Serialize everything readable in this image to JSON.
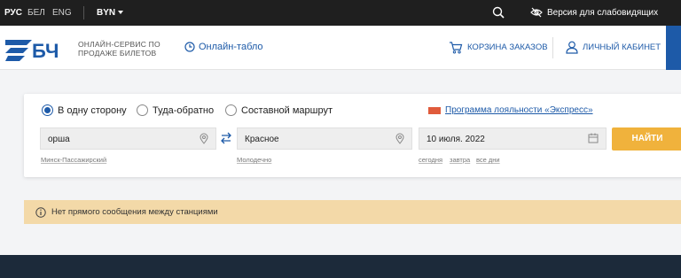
{
  "topbar": {
    "languages": [
      "РУС",
      "БЕЛ",
      "ENG"
    ],
    "currency": "BYN",
    "accessibility_label": "Версия для слабовидящих"
  },
  "header": {
    "logo_text": "БЧ",
    "service_line1": "Онлайн-сервис по",
    "service_line2": "продаже билетов",
    "online_board": "Онлайн-табло",
    "cart": "Корзина заказов",
    "account": "Личный кабинет"
  },
  "search": {
    "trip_types": [
      "В одну сторону",
      "Туда-обратно",
      "Составной маршрут"
    ],
    "selected_trip_type": "В одну сторону",
    "loyalty_link": "Программа лояльности «Экспресс»",
    "from_value": "орша",
    "from_hint": "Минск-Пассажирский",
    "to_value": "Красное",
    "to_hint": "Молодечно",
    "date_value": "10 июля. 2022",
    "date_shortcuts": [
      "сегодня",
      "завтра",
      "все дни"
    ],
    "submit_label": "НАЙТИ"
  },
  "alert": {
    "message": "Нет прямого сообщения между станциями"
  },
  "colors": {
    "accent_blue": "#1d5aa8",
    "button_orange": "#f0b23c",
    "alert_bg": "#f3d9a8",
    "topbar_bg": "#1f1f1f"
  }
}
